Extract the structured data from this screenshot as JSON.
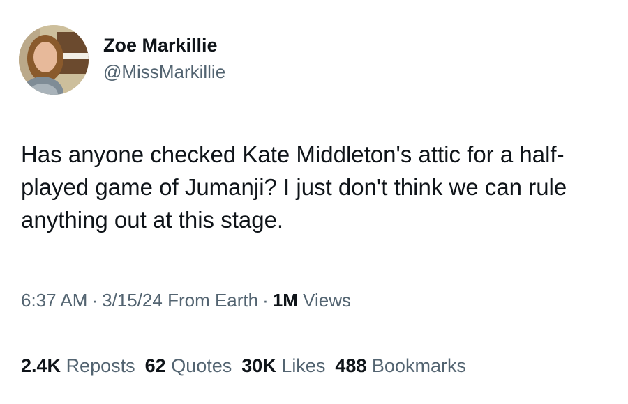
{
  "author": {
    "display_name": "Zoe Markillie",
    "handle": "@MissMarkillie"
  },
  "tweet": {
    "text": "Has anyone checked Kate Middleton's attic for a half-played game of Jumanji? I just don't think we can rule anything out at this stage."
  },
  "meta": {
    "time": "6:37 AM",
    "separator": "·",
    "date": "3/15/24",
    "source": "From Earth",
    "views_count": "1M",
    "views_label": "Views"
  },
  "stats": {
    "reposts_count": "2.4K",
    "reposts_label": "Reposts",
    "quotes_count": "62",
    "quotes_label": "Quotes",
    "likes_count": "30K",
    "likes_label": "Likes",
    "bookmarks_count": "488",
    "bookmarks_label": "Bookmarks"
  }
}
